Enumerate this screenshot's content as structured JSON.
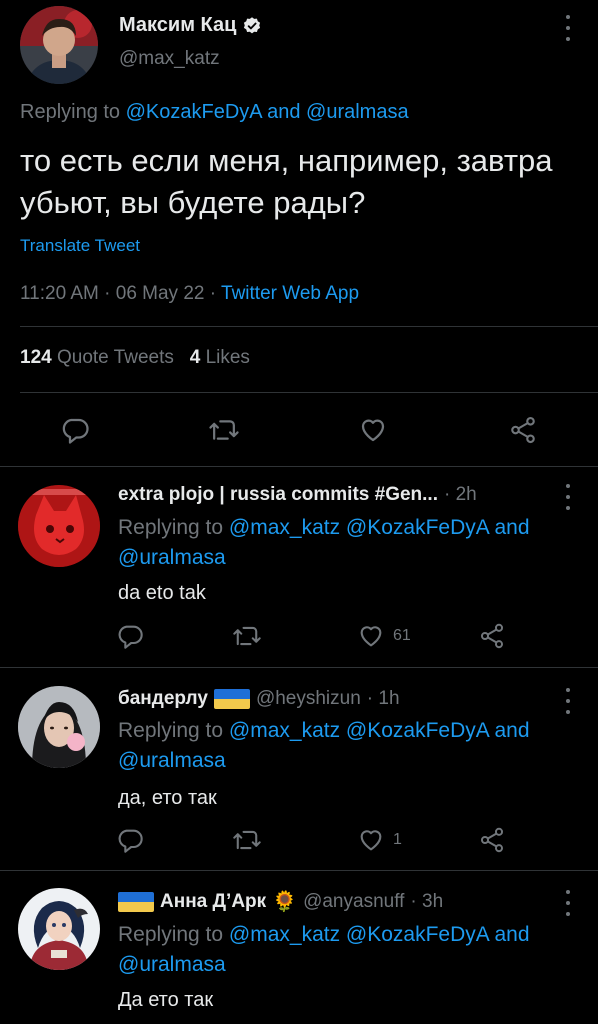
{
  "main_tweet": {
    "author_name": "Максим Кац",
    "handle": "@max_katz",
    "replying_prefix": "Replying to ",
    "replying_user1": "@KozakFeDyA",
    "replying_and": " and ",
    "replying_user2": "@uralmasa",
    "text": "то есть если меня, например, завтра убьют, вы будете рады?",
    "translate_label": "Translate Tweet",
    "time": "11:20 AM · 06 May 22 · ",
    "source": "Twitter Web App",
    "quote_count": "124",
    "quote_label": " Quote Tweets   ",
    "likes_count": "4",
    "likes_label": " Likes"
  },
  "replies": [
    {
      "author_name": "extra plojo | russia commits #Gen...",
      "handle": "",
      "time": "· 2h",
      "replying_prefix": "Replying to ",
      "mentions": "@max_katz @KozakFeDyA",
      "and": " and ",
      "last_mention": "@uralmasa",
      "text": "da eto tak",
      "reply_count": "",
      "retweet_count": "",
      "like_count": "61"
    },
    {
      "author_name": "бандерлу",
      "handle": "@heyshizun",
      "time": "· 1h",
      "replying_prefix": "Replying to ",
      "mentions": "@max_katz @KozakFeDyA",
      "and": " and ",
      "last_mention": "@uralmasa",
      "text": "да, ето так",
      "reply_count": "",
      "retweet_count": "",
      "like_count": "1"
    },
    {
      "author_name": "Анна Д’Арк",
      "handle": "@anyasnuff",
      "time": "· 3h",
      "replying_prefix": "Replying to ",
      "mentions": "@max_katz @KozakFeDyA",
      "and": " and ",
      "last_mention": "@uralmasa",
      "text": "Да ето так"
    }
  ],
  "icons": {
    "reply": "reply-icon",
    "retweet": "retweet-icon",
    "like": "heart-icon",
    "share": "share-icon",
    "verified": "verified-badge-icon",
    "more": "more-options-icon",
    "ukraine_flag": "ukraine-flag-icon",
    "sunflower": "sunflower-icon",
    "sunflower_glyph": "🌻"
  },
  "colors": {
    "background": "#000000",
    "text_primary": "#e7e9ea",
    "text_secondary": "#71767b",
    "link": "#1d9bf0",
    "divider": "#2f3336"
  }
}
